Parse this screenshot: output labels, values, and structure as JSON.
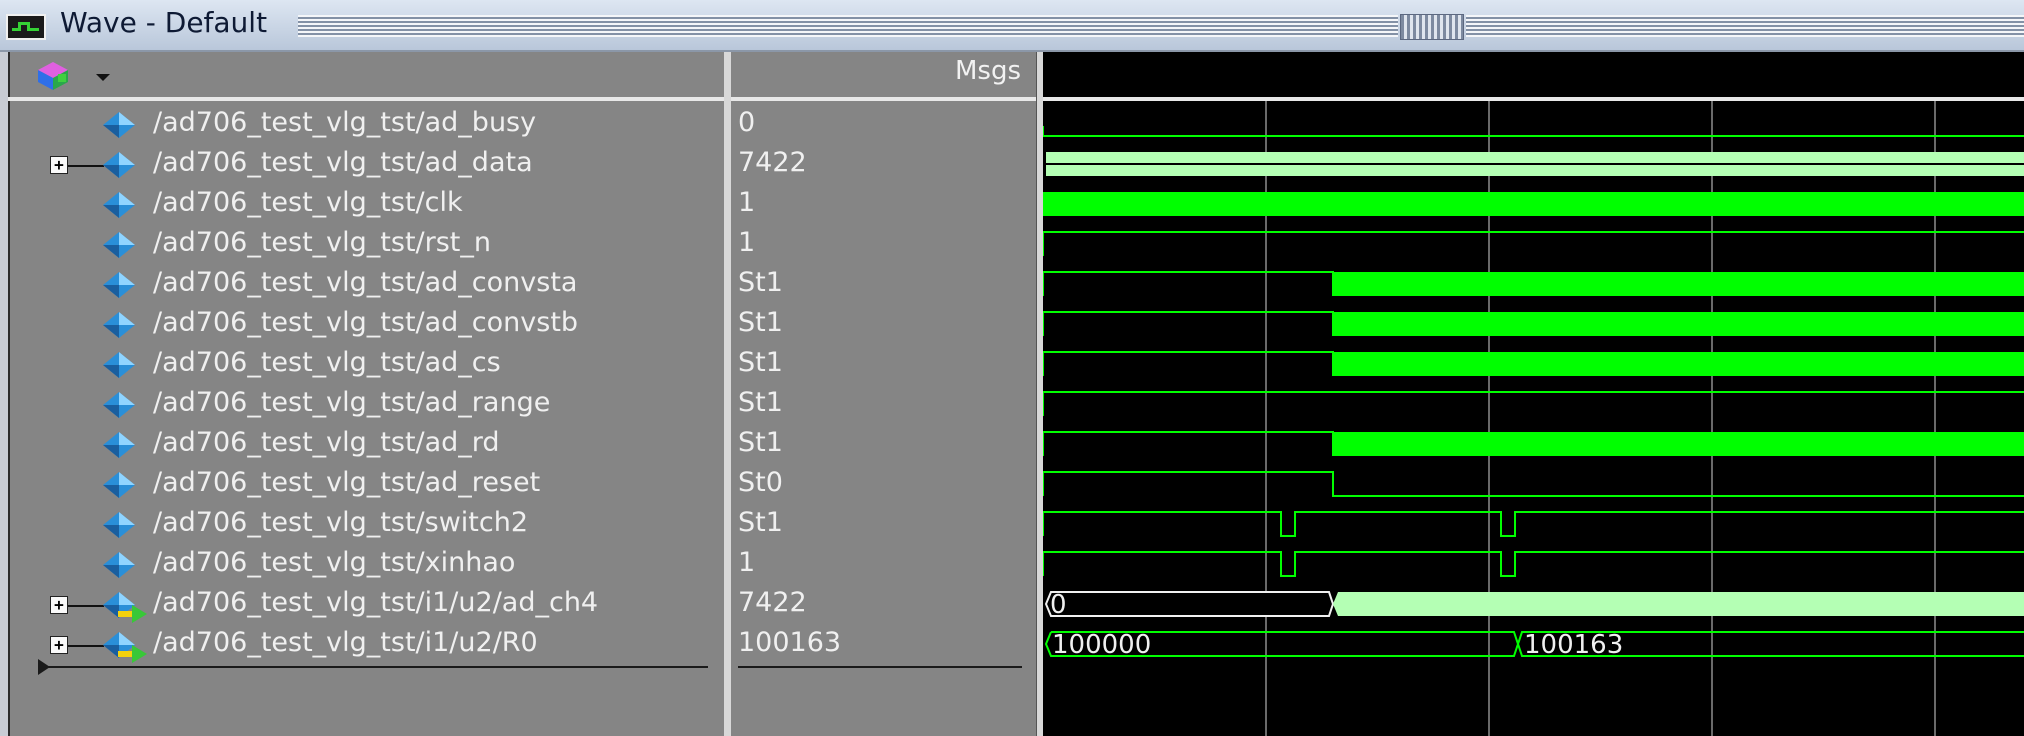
{
  "window": {
    "title": "Wave - Default"
  },
  "toolbar": {
    "menu_icon": "cube-icon",
    "dropdown_icon": "chevron-down-icon"
  },
  "header": {
    "msgs_label": "Msgs"
  },
  "colors": {
    "pane_bg": "#858585",
    "wave_bg": "#000000",
    "signal": "#00ff00",
    "bus_fill": "#b4ffb4",
    "grid": "#6a6a6a"
  },
  "signals": [
    {
      "name": "/ad706_test_vlg_tst/ad_busy",
      "value": "0",
      "expandable": false,
      "kind": "net"
    },
    {
      "name": "/ad706_test_vlg_tst/ad_data",
      "value": "7422",
      "expandable": true,
      "kind": "net"
    },
    {
      "name": "/ad706_test_vlg_tst/clk",
      "value": "1",
      "expandable": false,
      "kind": "net"
    },
    {
      "name": "/ad706_test_vlg_tst/rst_n",
      "value": "1",
      "expandable": false,
      "kind": "net"
    },
    {
      "name": "/ad706_test_vlg_tst/ad_convsta",
      "value": "St1",
      "expandable": false,
      "kind": "net"
    },
    {
      "name": "/ad706_test_vlg_tst/ad_convstb",
      "value": "St1",
      "expandable": false,
      "kind": "net"
    },
    {
      "name": "/ad706_test_vlg_tst/ad_cs",
      "value": "St1",
      "expandable": false,
      "kind": "net"
    },
    {
      "name": "/ad706_test_vlg_tst/ad_range",
      "value": "St1",
      "expandable": false,
      "kind": "net"
    },
    {
      "name": "/ad706_test_vlg_tst/ad_rd",
      "value": "St1",
      "expandable": false,
      "kind": "net"
    },
    {
      "name": "/ad706_test_vlg_tst/ad_reset",
      "value": "St0",
      "expandable": false,
      "kind": "net"
    },
    {
      "name": "/ad706_test_vlg_tst/switch2",
      "value": "St1",
      "expandable": false,
      "kind": "net"
    },
    {
      "name": "/ad706_test_vlg_tst/xinhao",
      "value": "1",
      "expandable": false,
      "kind": "net"
    },
    {
      "name": "/ad706_test_vlg_tst/i1/u2/ad_ch4",
      "value": "7422",
      "expandable": true,
      "kind": "reg"
    },
    {
      "name": "/ad706_test_vlg_tst/i1/u2/R0",
      "value": "100163",
      "expandable": true,
      "kind": "reg"
    }
  ],
  "waveforms": {
    "bus_labels": {
      "ad_ch4_initial": "0",
      "R0_initial": "100000",
      "R0_after": "100163"
    }
  }
}
